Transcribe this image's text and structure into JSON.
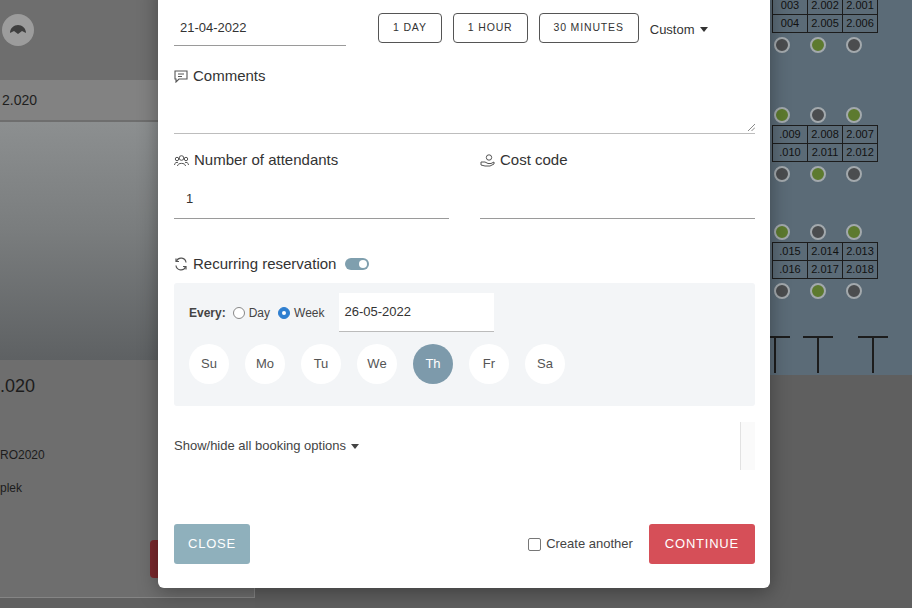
{
  "page": {
    "header": "2.020",
    "title": ".020",
    "code": "RO2020",
    "type": "plek"
  },
  "floor_plan": {
    "groups": [
      {
        "seats_top": [],
        "rows": [
          [
            "003",
            "2.002",
            "2.001"
          ],
          [
            "004",
            "2.005",
            "2.006"
          ]
        ],
        "seats_bottom": [
          {
            "color": "#4b4d4f"
          },
          {
            "color": "#5d7a2f"
          },
          {
            "color": "#4b4d4f"
          }
        ]
      },
      {
        "seats_top": [
          {
            "color": "#5d7a2f"
          },
          {
            "color": "#4b4d4f"
          },
          {
            "color": "#5d7a2f"
          }
        ],
        "rows": [
          [
            ".009",
            "2.008",
            "2.007"
          ],
          [
            ".010",
            "2.011",
            "2.012"
          ]
        ],
        "seats_bottom": [
          {
            "color": "#4b4d4f"
          },
          {
            "color": "#5d7a2f"
          },
          {
            "color": "#4b4d4f"
          }
        ]
      },
      {
        "seats_top": [
          {
            "color": "#5d7a2f"
          },
          {
            "color": "#4b4d4f"
          },
          {
            "color": "#5d7a2f"
          }
        ],
        "rows": [
          [
            ".015",
            "2.014",
            "2.013"
          ],
          [
            ".016",
            "2.017",
            "2.018"
          ]
        ],
        "seats_bottom": [
          {
            "color": "#4b4d4f"
          },
          {
            "color": "#5d7a2f"
          },
          {
            "color": "#4b4d4f"
          }
        ]
      }
    ]
  },
  "booking": {
    "date": "21-04-2022",
    "durations": [
      {
        "label": "1 DAY"
      },
      {
        "label": "1 HOUR"
      },
      {
        "label": "30 MINUTES"
      }
    ],
    "custom": "Custom",
    "comments": {
      "label": "Comments"
    },
    "attendants": {
      "label": "Number of attendants",
      "value": "1"
    },
    "cost_code": {
      "label": "Cost code"
    },
    "recurring": {
      "label": "Recurring reservation",
      "on": true
    },
    "every": {
      "label": "Every:",
      "options": [
        {
          "label": "Day",
          "selected": false
        },
        {
          "label": "Week",
          "selected": true
        }
      ],
      "until": "26-05-2022"
    },
    "days": [
      {
        "label": "Su",
        "selected": false
      },
      {
        "label": "Mo",
        "selected": false
      },
      {
        "label": "Tu",
        "selected": false
      },
      {
        "label": "We",
        "selected": false
      },
      {
        "label": "Th",
        "selected": true
      },
      {
        "label": "Fr",
        "selected": false
      },
      {
        "label": "Sa",
        "selected": false
      }
    ],
    "options_toggle": "Show/hide all booking options",
    "create_another": {
      "label": "Create another",
      "checked": false
    },
    "buttons": [
      {
        "label": "CLOSE",
        "kind": "secondary"
      },
      {
        "label": "CONTINUE",
        "kind": "primary"
      }
    ]
  }
}
